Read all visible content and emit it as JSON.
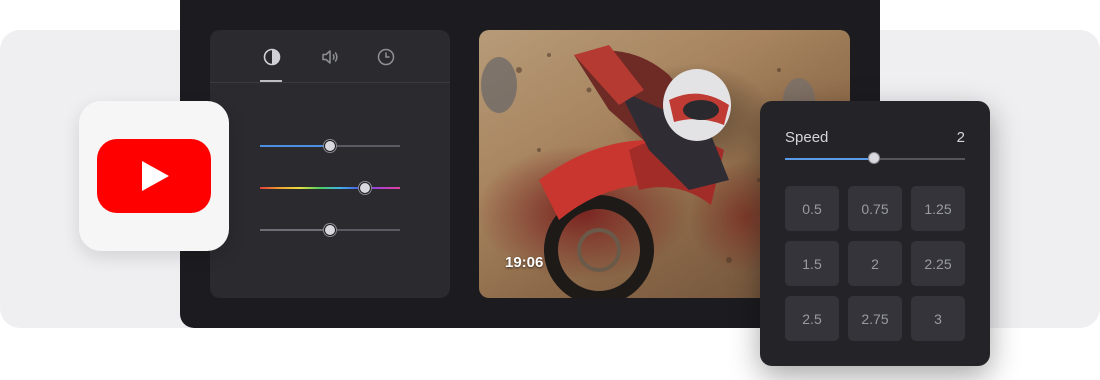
{
  "controls": {
    "tabs": [
      {
        "name": "contrast-icon"
      },
      {
        "name": "volume-icon"
      },
      {
        "name": "clock-icon"
      }
    ],
    "active_tab": 0,
    "sliders": [
      {
        "name": "brightness-slider",
        "value": 0.5,
        "fill_color": "#4c8fe0"
      },
      {
        "name": "hue-slider",
        "value": 0.75,
        "gradient": true
      },
      {
        "name": "neutral-slider",
        "value": 0.5,
        "fill_color": "#6e6e76"
      }
    ]
  },
  "video": {
    "timestamp": "19:06"
  },
  "logo": {
    "icon": "youtube-logo-icon",
    "brand_color": "#ff0000"
  },
  "speed": {
    "label": "Speed",
    "value": "2",
    "slider_fraction": 0.5,
    "accent": "#5b9be8",
    "options": [
      "0.5",
      "0.75",
      "1.25",
      "1.5",
      "2",
      "2.25",
      "2.5",
      "2.75",
      "3"
    ]
  }
}
